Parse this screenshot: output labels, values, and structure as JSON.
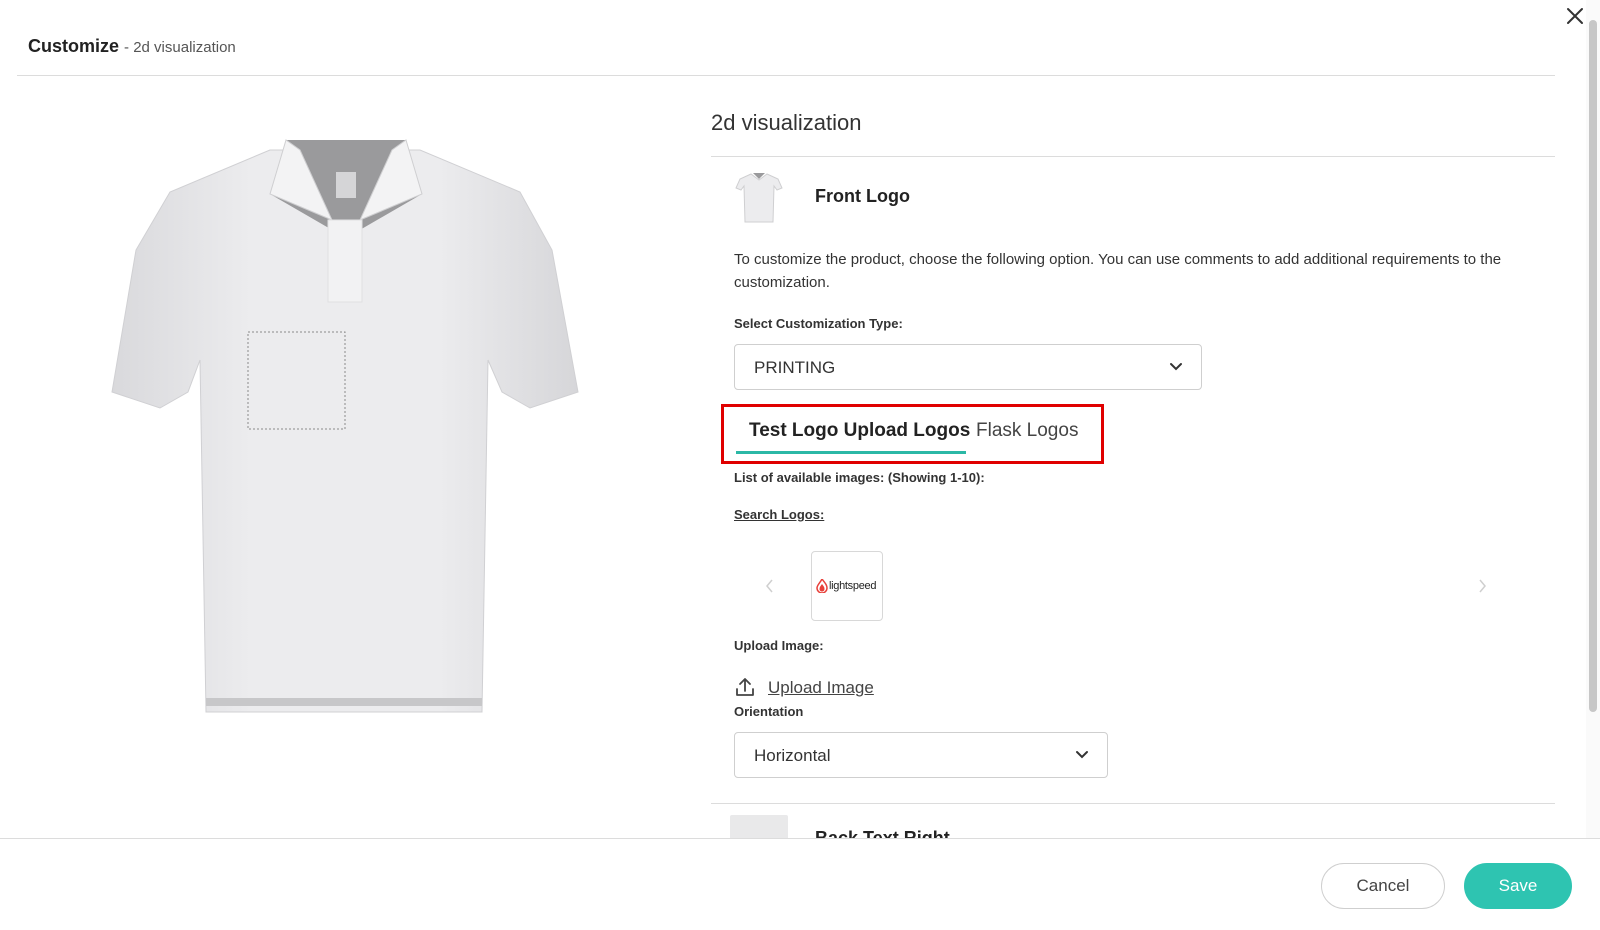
{
  "header": {
    "title": "Customize",
    "subtitle": "- 2d visualization"
  },
  "panel": {
    "title": "2d visualization",
    "front": {
      "name": "Front Logo",
      "description": "To customize the product, choose the following option. You can use comments to add additional requirements to the customization.",
      "customization_type_label": "Select Customization Type:",
      "customization_type_value": "PRINTING",
      "tabs": [
        {
          "label": "Test Logo Upload Logos",
          "active": true
        },
        {
          "label": "Flask Logos",
          "active": false
        }
      ],
      "list_label": "List of available images: (Showing 1-10):",
      "search_label": "Search Logos:",
      "logos": [
        {
          "brand_text": "lightspeed",
          "brand_color": "#e8403a"
        }
      ],
      "upload_label": "Upload Image:",
      "upload_link": "Upload Image",
      "orientation_label": "Orientation",
      "orientation_value": "Horizontal"
    },
    "back": {
      "name": "Back Text Right"
    }
  },
  "footer": {
    "cancel_label": "Cancel",
    "save_label": "Save"
  },
  "colors": {
    "accent": "#2ec4b1",
    "highlight_border": "#e00000"
  }
}
